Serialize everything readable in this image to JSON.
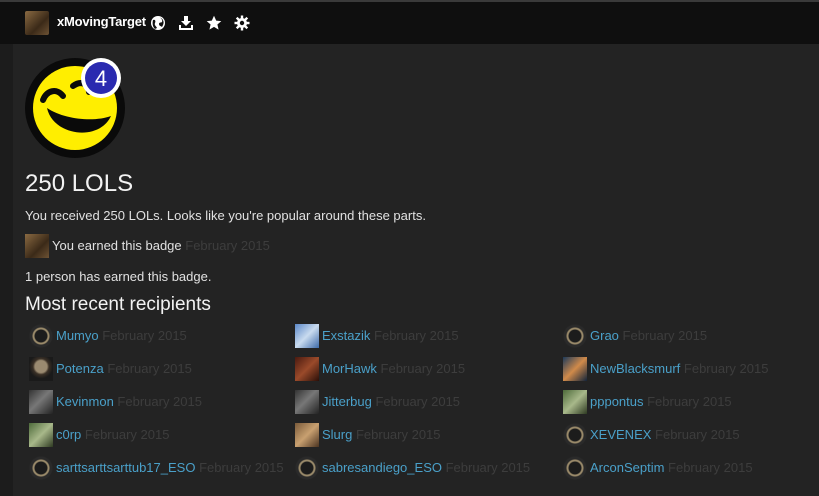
{
  "topbar": {
    "username": "xMovingTarget",
    "icons": [
      "globe-icon",
      "download-icon",
      "star-icon",
      "gear-icon"
    ]
  },
  "badge": {
    "level": "4",
    "title": "250 LOLS",
    "description": "You received 250 LOLs. Looks like you're popular around these parts.",
    "earned_text": "You earned this badge",
    "earned_date": "February 2015",
    "count_text": "1 person has earned this badge.",
    "recent_heading": "Most recent recipients"
  },
  "recipients": [
    {
      "name": "Mumyo",
      "date": "February 2015",
      "avatar": "ring"
    },
    {
      "name": "Exstazik",
      "date": "February 2015",
      "avatar": "blue"
    },
    {
      "name": "Grao",
      "date": "February 2015",
      "avatar": "ring"
    },
    {
      "name": "Potenza",
      "date": "February 2015",
      "avatar": "mask"
    },
    {
      "name": "MorHawk",
      "date": "February 2015",
      "avatar": "red"
    },
    {
      "name": "NewBlacksmurf",
      "date": "February 2015",
      "avatar": "teal"
    },
    {
      "name": "Kevinmon",
      "date": "February 2015",
      "avatar": "dark"
    },
    {
      "name": "Jitterbug",
      "date": "February 2015",
      "avatar": "dark"
    },
    {
      "name": "pppontus",
      "date": "February 2015",
      "avatar": "green"
    },
    {
      "name": "c0rp",
      "date": "February 2015",
      "avatar": "green"
    },
    {
      "name": "Slurg",
      "date": "February 2015",
      "avatar": "tan"
    },
    {
      "name": "XEVENEX",
      "date": "February 2015",
      "avatar": "ring"
    },
    {
      "name": "sarttsarttsarttub17_ESO",
      "date": "February 2015",
      "avatar": "ring"
    },
    {
      "name": "sabresandiego_ESO",
      "date": "February 2015",
      "avatar": "ring"
    },
    {
      "name": "ArconSeptim",
      "date": "February 2015",
      "avatar": "ring"
    }
  ],
  "colors": {
    "link": "#4aa0c9",
    "muted_date": "#3d3d3d",
    "badge_yellow": "#ffee00",
    "badge_blue": "#2a2ab0"
  }
}
